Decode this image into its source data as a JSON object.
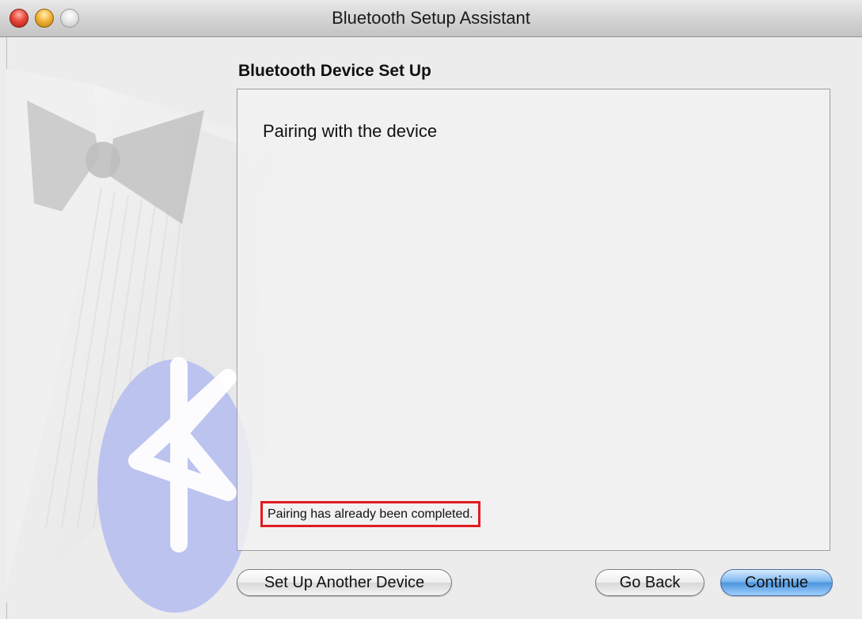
{
  "window": {
    "title": "Bluetooth Setup Assistant"
  },
  "section": {
    "title": "Bluetooth Device Set Up"
  },
  "panel": {
    "heading": "Pairing with the device",
    "status": "Pairing has already been completed."
  },
  "buttons": {
    "setup_another": "Set Up Another Device",
    "go_back": "Go Back",
    "continue": "Continue"
  },
  "colors": {
    "highlight_border": "#e11b22",
    "default_button": "#5aa2e6"
  },
  "icons": {
    "close": "close-icon",
    "minimize": "minimize-icon",
    "zoom": "zoom-icon",
    "background": "bluetooth-icon"
  }
}
